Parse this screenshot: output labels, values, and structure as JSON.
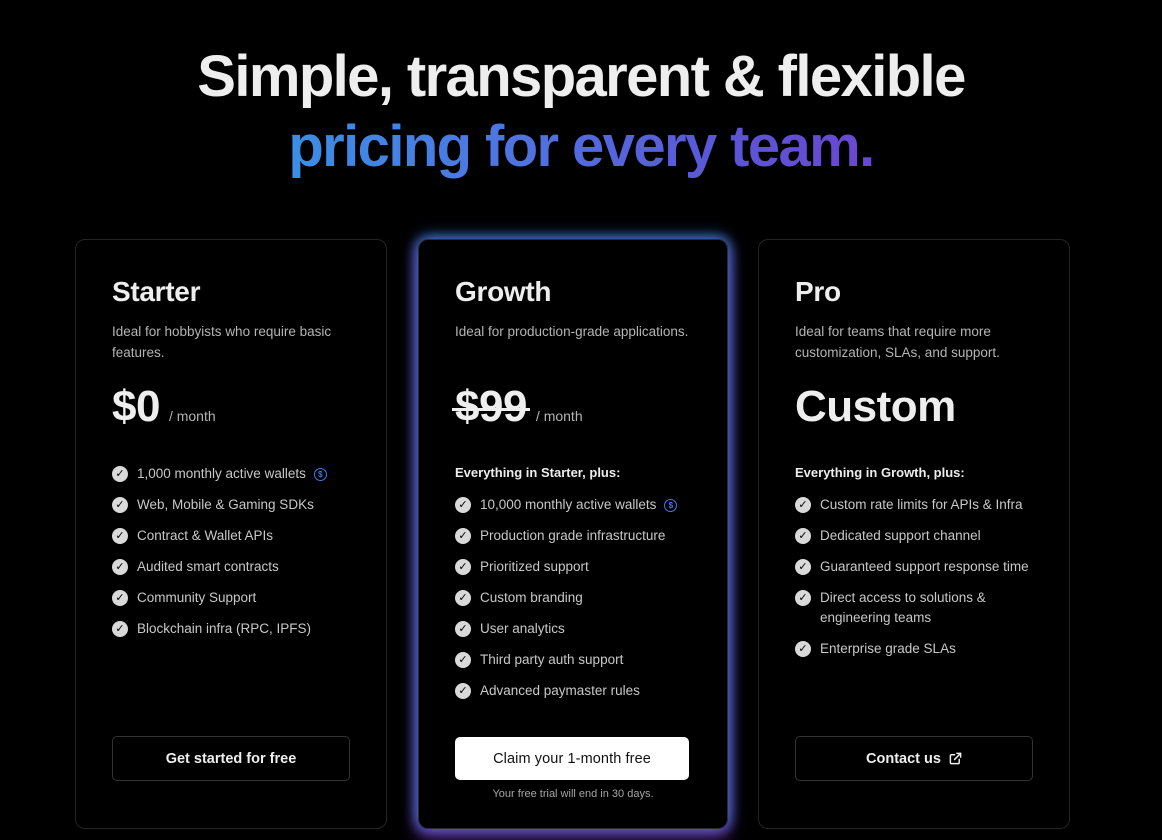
{
  "hero": {
    "line1": "Simple, transparent & flexible",
    "line2": "pricing for every team."
  },
  "plans": [
    {
      "name": "Starter",
      "description": "Ideal for hobbyists who require basic features.",
      "price": "$0",
      "per": "/ month",
      "features": [
        "1,000 monthly active wallets",
        "Web, Mobile & Gaming SDKs",
        "Contract & Wallet APIs",
        "Audited smart contracts",
        "Community Support",
        "Blockchain infra (RPC, IPFS)"
      ],
      "cta": "Get started for free"
    },
    {
      "name": "Growth",
      "description": "Ideal for production-grade applications.",
      "price": "$99",
      "per": "/ month",
      "includes": "Everything in Starter, plus:",
      "features": [
        "10,000 monthly active wallets",
        "Production grade infrastructure",
        "Prioritized support",
        "Custom branding",
        "User analytics",
        "Third party auth support",
        "Advanced paymaster rules"
      ],
      "cta": "Claim your 1-month free",
      "note": "Your free trial will end in 30 days."
    },
    {
      "name": "Pro",
      "description": "Ideal for teams that require more customization, SLAs, and support.",
      "price": "Custom",
      "includes": "Everything in Growth, plus:",
      "features": [
        "Custom rate limits for APIs & Infra",
        "Dedicated support channel",
        "Guaranteed support response time",
        "Direct access to solutions & engineering teams",
        "Enterprise grade SLAs"
      ],
      "cta": "Contact us"
    }
  ],
  "icons": {
    "check": "check-circle-icon",
    "coin": "dollar-coin-icon",
    "external": "external-link-icon"
  },
  "colors": {
    "background": "#000000",
    "gradient_start": "#3b8ee6",
    "gradient_end": "#6a47cf",
    "glow_top": "#3896f0",
    "glow_bottom": "#9646e6"
  }
}
